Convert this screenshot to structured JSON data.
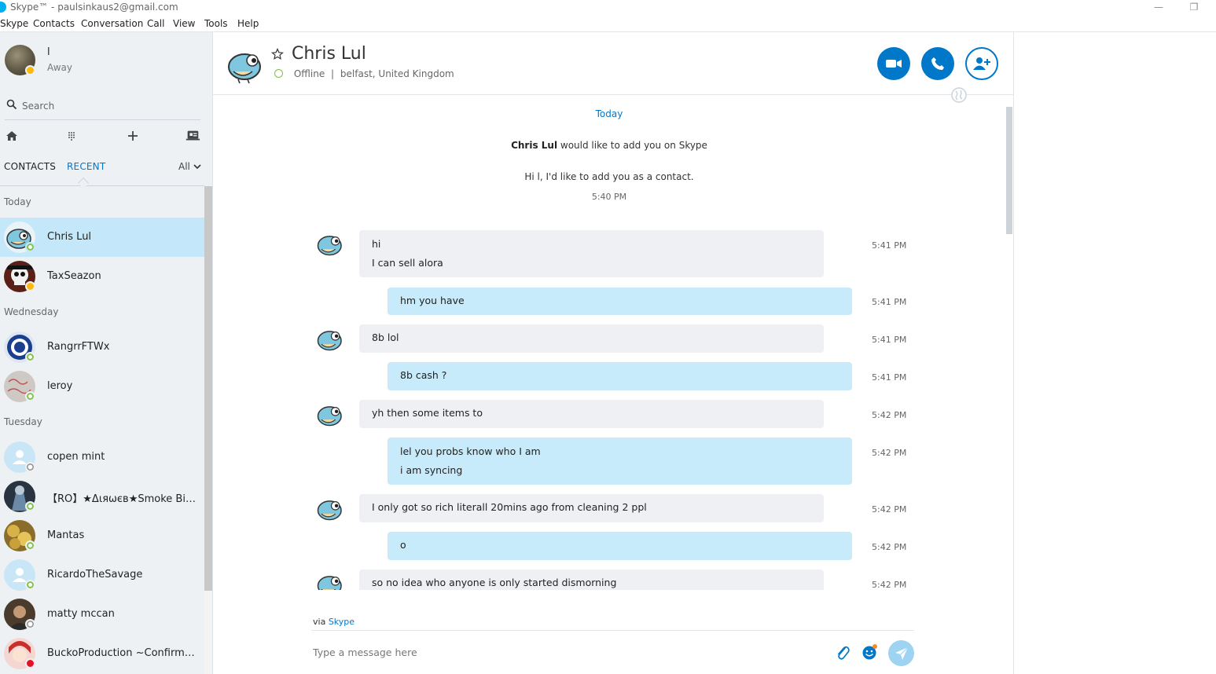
{
  "window": {
    "title": "Skype™ - paulsinkaus2@gmail.com",
    "minimize_glyph": "—",
    "restore_glyph": "❐"
  },
  "menu": [
    "Skype",
    "Contacts",
    "Conversation",
    "Call",
    "View",
    "Tools",
    "Help"
  ],
  "profile": {
    "name": "l",
    "status": "Away"
  },
  "search": {
    "placeholder": "Search"
  },
  "sidebar_tabs": {
    "contacts": "CONTACTS",
    "recent": "RECENT",
    "filter": "All"
  },
  "groups": {
    "today": "Today",
    "wednesday": "Wednesday",
    "tuesday": "Tuesday"
  },
  "recent": [
    {
      "name": "Chris Lul",
      "status": "online",
      "selected": true
    },
    {
      "name": "TaxSeazon",
      "status": "away"
    },
    {
      "name": "RangrrFTWx",
      "status": "online"
    },
    {
      "name": "leroy",
      "status": "online"
    },
    {
      "name": "copen mint",
      "status": "unknown"
    },
    {
      "name": "【RO】★Διяωєв★Smoke Big【...",
      "status": "online"
    },
    {
      "name": "Mantas",
      "status": "online"
    },
    {
      "name": "RicardoTheSavage",
      "status": "online"
    },
    {
      "name": "matty mccan",
      "status": "unknown"
    },
    {
      "name": "BuckoProduction ~Confirm vi...",
      "status": "busy"
    }
  ],
  "conversation": {
    "contact_name": "Chris Lul",
    "presence": "Offline",
    "location": "belfast, United Kingdom",
    "separator": "|",
    "day_label": "Today",
    "request_name": "Chris Lul",
    "request_text": " would like to add you on Skype",
    "request_message": "Hi l, I'd like to add you as a contact.",
    "request_time": "5:40 PM",
    "messages": [
      {
        "dir": "in",
        "lines": [
          "hi",
          "I can sell alora"
        ],
        "time": "5:41 PM"
      },
      {
        "dir": "out",
        "lines": [
          "hm you have"
        ],
        "time": "5:41 PM"
      },
      {
        "dir": "in",
        "lines": [
          "8b lol"
        ],
        "time": "5:41 PM"
      },
      {
        "dir": "out",
        "lines": [
          "8b cash ?"
        ],
        "time": "5:41 PM"
      },
      {
        "dir": "in",
        "lines": [
          "yh then some items to"
        ],
        "time": "5:42 PM"
      },
      {
        "dir": "out",
        "lines": [
          "lel you probs know who I am",
          "i am syncing"
        ],
        "time": "5:42 PM"
      },
      {
        "dir": "in",
        "lines": [
          "I only got so rich literall 20mins ago from cleaning 2 ppl"
        ],
        "time": "5:42 PM"
      },
      {
        "dir": "out",
        "lines": [
          "o"
        ],
        "time": "5:42 PM"
      },
      {
        "dir": "in",
        "lines": [
          "so no idea who anyone is only started dismorning"
        ],
        "time": "5:42 PM"
      }
    ]
  },
  "composer": {
    "via_prefix": "via ",
    "via_link": "Skype",
    "placeholder": "Type a message here"
  },
  "colors": {
    "accent": "#0078ca",
    "selected_row": "#c4e8f9",
    "outgoing_bubble": "#c7ebfb",
    "incoming_bubble": "#eef0f4",
    "online": "#7dc243",
    "away": "#fdb913",
    "busy": "#e81123"
  },
  "icons": {
    "search": "search-icon",
    "home": "home-icon",
    "dialpad": "dialpad-icon",
    "add": "plus-icon",
    "contacts_book": "contact-card-icon",
    "star": "star-icon",
    "video": "video-call-icon",
    "call": "phone-icon",
    "add_people": "add-person-icon",
    "globe": "globe-icon",
    "attach": "paperclip-icon",
    "emoticon": "emoticon-icon",
    "send": "send-icon"
  }
}
